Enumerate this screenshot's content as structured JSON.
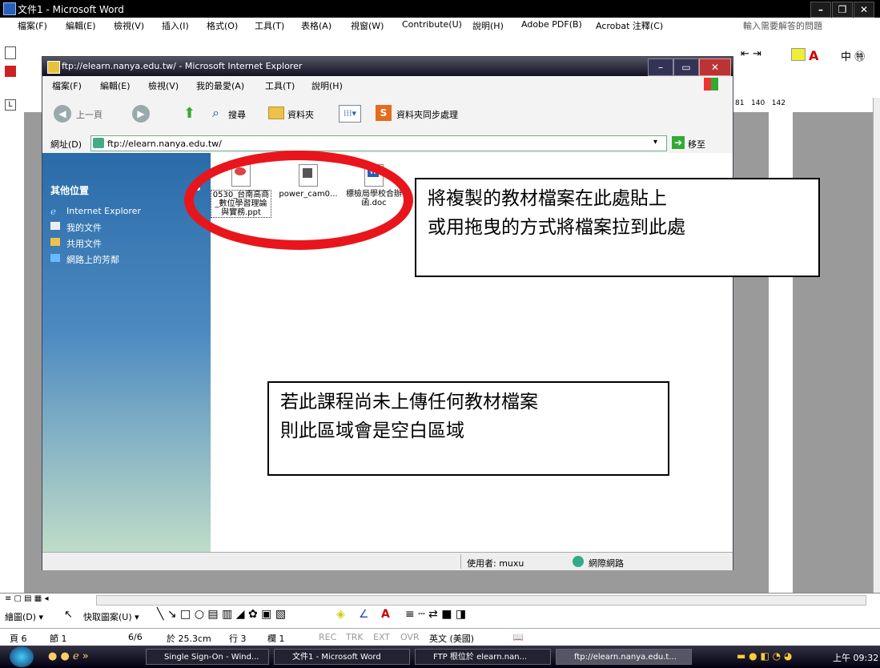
{
  "word": {
    "title": "文件1 - Microsoft Word",
    "menu": [
      "檔案(F)",
      "編輯(E)",
      "檢視(V)",
      "插入(I)",
      "格式(O)",
      "工具(T)",
      "表格(A)",
      "視窗(W)",
      "Contribute(U)",
      "說明(H)",
      "Adobe PDF(B)",
      "Acrobat 注釋(C)"
    ],
    "help_placeholder": "輸入需要解答的問題",
    "ruler_right": "81   140   142",
    "draw_label": "繪圖(D) ▾",
    "autoshape_label": "快取圖案(U) ▾",
    "status": {
      "page": "頁 6",
      "section": "節 1",
      "pages": "6/6",
      "at": "於 25.3cm",
      "line": "行 3",
      "col": "欄 1",
      "rec": "REC",
      "trk": "TRK",
      "ext": "EXT",
      "ovr": "OVR",
      "lang": "英文 (美國)"
    }
  },
  "ie": {
    "title": "ftp://elearn.nanya.edu.tw/ - Microsoft Internet Explorer",
    "menu": [
      "檔案(F)",
      "編輯(E)",
      "檢視(V)",
      "我的最愛(A)",
      "工具(T)",
      "說明(H)"
    ],
    "back_label": "上一頁",
    "search_label": "搜尋",
    "folders_label": "資料夾",
    "sync_label": "資料夾同步處理",
    "address_label": "網址(D)",
    "address_value": "ftp://elearn.nanya.edu.tw/",
    "go_label": "移至",
    "side_heading": "其他位置",
    "side_items": [
      "Internet Explorer",
      "我的文件",
      "共用文件",
      "網路上的芳鄰"
    ],
    "files": [
      {
        "name": "0530_台南高商_數位學習理論與實務.ppt",
        "type": "ppt"
      },
      {
        "name": "power_cam0...",
        "type": "wmv"
      },
      {
        "name": "標檢局學校合辦函.doc",
        "type": "doc"
      }
    ],
    "status_user": "使用者: muxu",
    "status_zone": "網際網路"
  },
  "callouts": {
    "paste_line1": "將複製的教材檔案在此處貼上",
    "paste_line2": "或用拖曳的方式將檔案拉到此處",
    "empty_line1": "若此課程尚未上傳任何教材檔案",
    "empty_line2": "則此區域會是空白區域"
  },
  "taskbar": {
    "tasks": [
      "Single Sign-On - Wind...",
      "文件1 - Microsoft Word",
      "FTP 根位於 elearn.nan...",
      "ftp://elearn.nanya.edu.t..."
    ],
    "clock": "上午 09:32"
  },
  "colors": {
    "highlight_ring": "#e8161c",
    "side_panel": "#2a6ba9"
  }
}
